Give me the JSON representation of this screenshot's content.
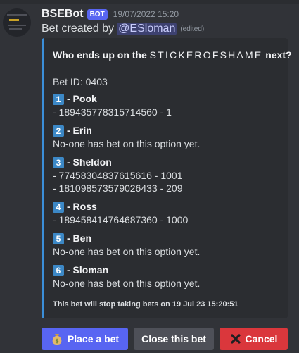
{
  "message": {
    "author": "BSEBot",
    "badge": "BOT",
    "timestamp": "19/07/2022 15:20",
    "content_prefix": "Bet created by",
    "mention": "@ESloman",
    "edited": "(edited)"
  },
  "embed": {
    "title_prefix": "Who ends up on the",
    "title_spaced": "STICKEROFSHAME",
    "title_suffix": "next?",
    "bet_id": "Bet ID: 0403",
    "options": [
      {
        "number": "1",
        "name": "- Pook",
        "lines": [
          "- 189435778315714560 - 1"
        ]
      },
      {
        "number": "2",
        "name": "- Erin",
        "lines": [
          "No-one has bet on this option yet."
        ]
      },
      {
        "number": "3",
        "name": "- Sheldon",
        "lines": [
          "- 774583048376156​16 - 1001",
          "- 181098573579026433 - 209"
        ]
      },
      {
        "number": "4",
        "name": "- Ross",
        "lines": [
          "- 189458414764687360 - 1000"
        ]
      },
      {
        "number": "5",
        "name": "- Ben",
        "lines": [
          "No-one has bet on this option yet."
        ]
      },
      {
        "number": "6",
        "name": "- Sloman",
        "lines": [
          "No-one has bet on this option yet."
        ]
      }
    ],
    "footer": "This bet will stop taking bets on 19 Jul 23 15:20:51",
    "accent_color": "#3b8ed8"
  },
  "buttons": {
    "place": "Place a bet",
    "close": "Close this bet",
    "cancel": "Cancel"
  },
  "colors": {
    "blurple": "#5865f2",
    "secondary": "#4e5058",
    "danger": "#da373c"
  }
}
